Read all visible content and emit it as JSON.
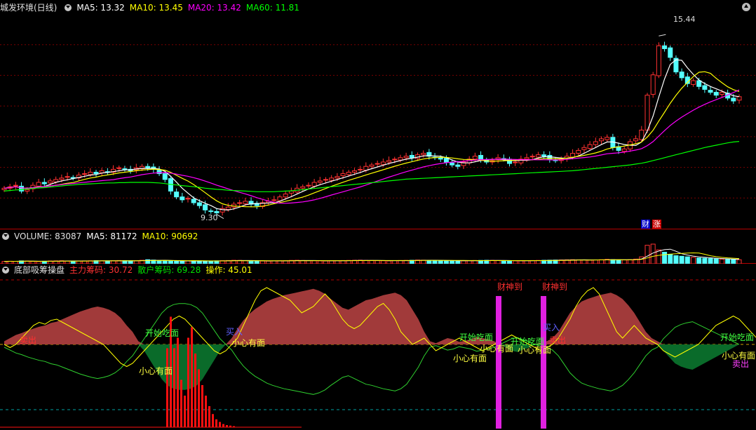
{
  "price_header": {
    "stock_name": "城发环境(日线)",
    "ma5": "MA5: 13.32",
    "ma10": "MA10: 13.45",
    "ma20": "MA20: 13.42",
    "ma60": "MA60: 11.81"
  },
  "volume_header": {
    "volume": "VOLUME: 83087",
    "ma5": "MA5: 81172",
    "ma10": "MA10: 90692"
  },
  "indicator_header": {
    "name": "底部吸筹操盘",
    "main_chips": "主力筹码: 30.72",
    "retail_chips": "散户筹码: 69.28",
    "operation": "操作: 45.01"
  },
  "price_markers": {
    "high_label": "15.44",
    "low_label": "9.30",
    "badge1": "财",
    "badge2": "涨"
  },
  "signals": {
    "start_eat": "开始吃面",
    "careful": "小心有面",
    "fortune": "财神到",
    "buy": "买入",
    "sell": "卖出"
  },
  "colors": {
    "up": "#ff3232",
    "down": "#54ffff",
    "ma5": "#ffffff",
    "ma10": "#ffff00",
    "ma20": "#ff00ff",
    "ma60": "#00ff00",
    "main_fill": "#a13a3a",
    "retail_fill": "#0a6b2a"
  },
  "chart_data": [
    {
      "type": "candlestick",
      "panel": "price",
      "series_names": [
        "MA5",
        "MA10",
        "MA20",
        "MA60"
      ],
      "ylim": [
        9.0,
        16.0
      ],
      "high": 15.44,
      "low": 9.3,
      "close": [
        10.2,
        10.25,
        10.3,
        10.1,
        10.15,
        10.3,
        10.4,
        10.35,
        10.45,
        10.5,
        10.55,
        10.6,
        10.55,
        10.65,
        10.7,
        10.75,
        10.7,
        10.8,
        10.75,
        10.85,
        10.9,
        10.85,
        10.8,
        10.9,
        10.95,
        10.9,
        10.85,
        10.7,
        10.5,
        10.1,
        9.9,
        9.8,
        9.85,
        9.7,
        9.6,
        9.45,
        9.4,
        9.35,
        9.5,
        9.55,
        9.65,
        9.7,
        9.75,
        9.65,
        9.6,
        9.7,
        9.75,
        9.8,
        9.9,
        10.0,
        10.1,
        10.2,
        10.25,
        10.3,
        10.4,
        10.45,
        10.5,
        10.55,
        10.6,
        10.7,
        10.75,
        10.8,
        10.85,
        10.95,
        11.0,
        11.05,
        11.1,
        11.15,
        11.2,
        11.25,
        11.3,
        11.25,
        11.35,
        11.4,
        11.3,
        11.25,
        11.2,
        11.1,
        11.0,
        10.95,
        11.1,
        11.2,
        11.3,
        11.2,
        11.1,
        11.15,
        11.25,
        11.2,
        11.05,
        11.1,
        11.2,
        11.25,
        11.3,
        11.35,
        11.3,
        11.2,
        11.15,
        11.2,
        11.3,
        11.4,
        11.5,
        11.6,
        11.7,
        11.8,
        11.9,
        11.95,
        11.6,
        11.5,
        11.55,
        11.8,
        11.9,
        12.2,
        13.4,
        14.1,
        15.1,
        15.0,
        14.7,
        14.2,
        14.0,
        13.8,
        13.9,
        13.7,
        13.6,
        13.5,
        13.4,
        13.5,
        13.3,
        13.2,
        13.35
      ],
      "ma60": [
        10.1,
        10.12,
        10.14,
        10.15,
        10.17,
        10.19,
        10.21,
        10.22,
        10.24,
        10.26,
        10.28,
        10.3,
        10.31,
        10.33,
        10.34,
        10.35,
        10.36,
        10.37,
        10.38,
        10.38,
        10.39,
        10.39,
        10.4,
        10.4,
        10.4,
        10.4,
        10.39,
        10.38,
        10.36,
        10.33,
        10.31,
        10.29,
        10.27,
        10.25,
        10.23,
        10.2,
        10.18,
        10.16,
        10.15,
        10.13,
        10.12,
        10.11,
        10.1,
        10.09,
        10.08,
        10.08,
        10.08,
        10.08,
        10.09,
        10.1,
        10.11,
        10.13,
        10.15,
        10.17,
        10.19,
        10.21,
        10.23,
        10.25,
        10.27,
        10.29,
        10.31,
        10.33,
        10.35,
        10.37,
        10.39,
        10.41,
        10.43,
        10.45,
        10.47,
        10.49,
        10.51,
        10.52,
        10.53,
        10.54,
        10.55,
        10.56,
        10.57,
        10.58,
        10.59,
        10.6,
        10.61,
        10.62,
        10.63,
        10.64,
        10.65,
        10.66,
        10.67,
        10.68,
        10.69,
        10.7,
        10.71,
        10.72,
        10.73,
        10.74,
        10.75,
        10.76,
        10.77,
        10.78,
        10.79,
        10.8,
        10.82,
        10.84,
        10.86,
        10.88,
        10.9,
        10.92,
        10.94,
        10.96,
        10.98,
        11.0,
        11.03,
        11.06,
        11.1,
        11.15,
        11.2,
        11.25,
        11.3,
        11.35,
        11.4,
        11.45,
        11.5,
        11.55,
        11.6,
        11.64,
        11.68,
        11.72,
        11.76,
        11.79,
        11.81
      ]
    },
    {
      "type": "bar",
      "panel": "volume",
      "series_names": [
        "VOLUME",
        "MA5",
        "MA10"
      ],
      "values": [
        20,
        22,
        21,
        25,
        23,
        20,
        19,
        22,
        24,
        25,
        26,
        23,
        22,
        24,
        25,
        26,
        27,
        25,
        24,
        26,
        28,
        27,
        26,
        25,
        30,
        35,
        32,
        28,
        26,
        25,
        23,
        22,
        24,
        26,
        25,
        23,
        24,
        25,
        27,
        28,
        30,
        29,
        27,
        26,
        25,
        24,
        23,
        25,
        26,
        27,
        29,
        30,
        28,
        27,
        26,
        25,
        24,
        26,
        27,
        28,
        29,
        30,
        31,
        29,
        28,
        27,
        26,
        25,
        27,
        28,
        29,
        30,
        32,
        31,
        30,
        29,
        28,
        27,
        26,
        25,
        26,
        27,
        28,
        29,
        30,
        29,
        28,
        27,
        26,
        25,
        26,
        27,
        28,
        29,
        30,
        31,
        32,
        33,
        34,
        35,
        34,
        33,
        32,
        33,
        35,
        38,
        36,
        34,
        33,
        35,
        40,
        60,
        160,
        170,
        120,
        100,
        80,
        70,
        65,
        60,
        55,
        50,
        48,
        45,
        42,
        40,
        38,
        36,
        35
      ]
    },
    {
      "type": "area",
      "panel": "indicator",
      "series_names": [
        "主力筹码",
        "散户筹码",
        "操作"
      ],
      "ylim": [
        -100,
        100
      ],
      "main": [
        5,
        10,
        15,
        18,
        22,
        25,
        28,
        30,
        34,
        36,
        40,
        44,
        48,
        52,
        55,
        58,
        60,
        58,
        55,
        50,
        42,
        30,
        20,
        5,
        -10,
        -25,
        -40,
        -55,
        -65,
        -70,
        -72,
        -72,
        -70,
        -65,
        -55,
        -40,
        -25,
        -10,
        0,
        10,
        25,
        38,
        48,
        56,
        62,
        68,
        72,
        75,
        78,
        80,
        82,
        84,
        86,
        88,
        85,
        80,
        72,
        65,
        58,
        55,
        60,
        65,
        70,
        72,
        75,
        78,
        80,
        82,
        78,
        70,
        55,
        40,
        20,
        5,
        2,
        6,
        10,
        8,
        4,
        6,
        8,
        12,
        10,
        8,
        5,
        0,
        -5,
        -10,
        -12,
        -8,
        -5,
        0,
        3,
        5,
        10,
        20,
        35,
        50,
        60,
        68,
        72,
        75,
        78,
        80,
        82,
        78,
        72,
        62,
        50,
        35,
        20,
        10,
        5,
        -10,
        -20,
        -30,
        -35,
        -38,
        -40,
        -35,
        -30,
        -25,
        -20,
        -15,
        -10,
        -5,
        0
      ],
      "operation": [
        0,
        -5,
        0,
        10,
        20,
        30,
        35,
        32,
        38,
        40,
        35,
        30,
        25,
        20,
        15,
        10,
        5,
        0,
        -10,
        -20,
        -30,
        -35,
        -30,
        -20,
        -10,
        0,
        10,
        20,
        30,
        40,
        45,
        40,
        30,
        20,
        10,
        0,
        -10,
        -15,
        -10,
        0,
        10,
        30,
        50,
        70,
        85,
        90,
        85,
        80,
        75,
        70,
        60,
        50,
        55,
        60,
        70,
        80,
        70,
        55,
        40,
        30,
        25,
        30,
        40,
        50,
        60,
        65,
        55,
        40,
        20,
        10,
        0,
        5,
        10,
        0,
        -10,
        -5,
        0,
        5,
        10,
        5,
        0,
        -5,
        -10,
        -5,
        0,
        5,
        10,
        15,
        10,
        5,
        0,
        -5,
        -10,
        -5,
        0,
        10,
        25,
        40,
        60,
        75,
        85,
        90,
        80,
        60,
        40,
        20,
        10,
        20,
        30,
        20,
        10,
        5,
        0,
        -10,
        -15,
        -20,
        -15,
        -10,
        -5,
        0,
        10,
        20,
        30,
        35,
        40,
        45,
        40,
        30,
        20,
        10,
        0
      ]
    }
  ]
}
